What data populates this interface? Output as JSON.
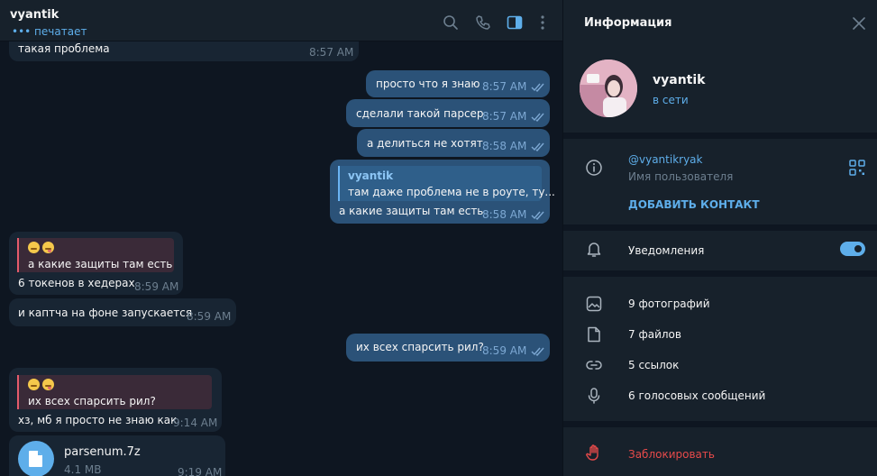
{
  "chat": {
    "title": "vyantik",
    "status": "••• печатает",
    "header_icons": [
      "search-icon",
      "phone-icon",
      "sidebar-toggle-icon",
      "more-vertical-icon"
    ]
  },
  "messages": {
    "m0": {
      "text": "такая проблема",
      "time": "8:57 AM"
    },
    "m1": {
      "text": "просто что я знаю",
      "time": "8:57 AM"
    },
    "m2": {
      "text": "сделали такой парсер",
      "time": "8:57 AM"
    },
    "m3": {
      "text": "а делиться не хотят",
      "time": "8:58 AM"
    },
    "m4": {
      "reply_name": "vyantik",
      "reply_text": "там даже проблема не в роуте, ту...",
      "text": "а какие защиты там есть",
      "time": "8:58 AM"
    },
    "m5": {
      "reply_text": "а какие защиты там есть",
      "text": "6 токенов в хедерах",
      "time": "8:59 AM"
    },
    "m6": {
      "text": "и каптча на фоне запускается",
      "time": "8:59 AM"
    },
    "m7": {
      "text": "их всех спарсить рил?",
      "time": "8:59 AM"
    },
    "m8": {
      "reply_text": "их всех спарсить рил?",
      "text": "хз, мб я просто не знаю как",
      "time": "9:14 AM"
    },
    "m9": {
      "file_name": "parsenum.7z",
      "file_size": "4.1 MB",
      "time": "9:19 AM"
    }
  },
  "info": {
    "title": "Информация",
    "name": "vyantik",
    "status": "в сети",
    "username": "@vyantikryak",
    "username_caption": "Имя пользователя",
    "add_contact": "ДОБАВИТЬ КОНТАКТ",
    "notifications": "Уведомления",
    "notifications_on": true,
    "media": {
      "photos": "9 фотографий",
      "files": "7 файлов",
      "links": "5 ссылок",
      "voice": "6 голосовых сообщений"
    },
    "block": "Заблокировать"
  },
  "colors": {
    "accent": "#5eaeea",
    "outgoing_bubble": "#2b5278",
    "incoming_bubble": "#182533",
    "danger": "#e64a4a"
  }
}
